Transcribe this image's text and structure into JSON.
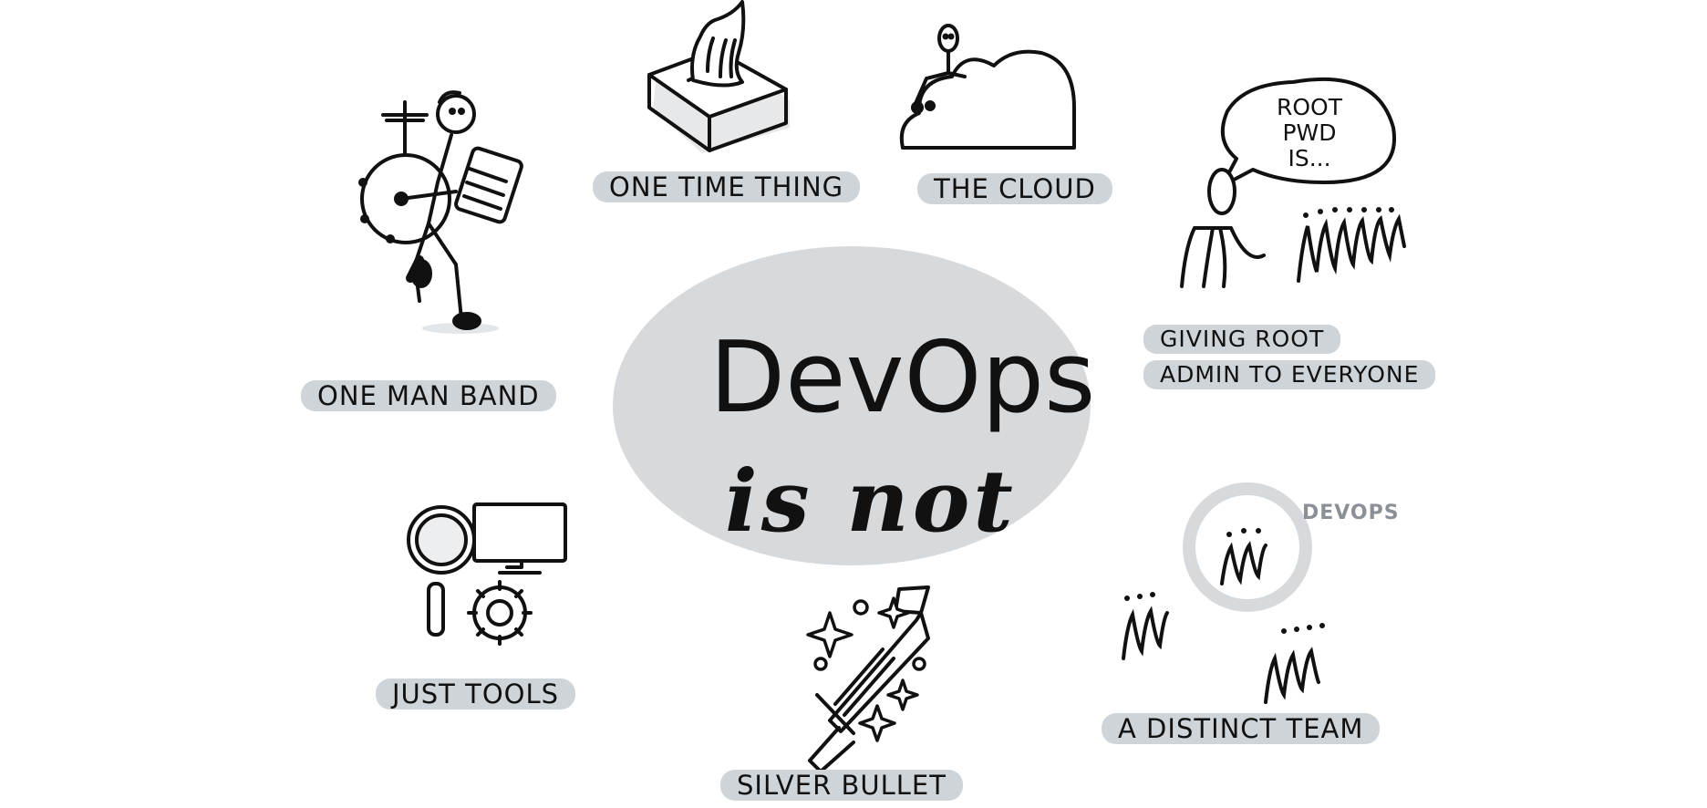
{
  "center": {
    "title": "DevOps",
    "subtitle": "is not"
  },
  "items": {
    "one_man_band": "ONE MAN BAND",
    "one_time_thing": "ONE TIME THING",
    "the_cloud": "THE CLOUD",
    "giving_root_line1": "GIVING ROOT",
    "giving_root_line2": "ADMIN TO EVERYONE",
    "just_tools": "JUST TOOLS",
    "silver_bullet": "SILVER BULLET",
    "distinct_team": "A DISTINCT TEAM"
  },
  "speech_bubble": {
    "text": "ROOT\nPWD\nIS..."
  },
  "team_circle_label": "DEVOPS",
  "colors": {
    "ink": "#111111",
    "pill": "#cfd4d8",
    "ellipse": "#d6dadd",
    "muted_label": "#8a9096"
  }
}
